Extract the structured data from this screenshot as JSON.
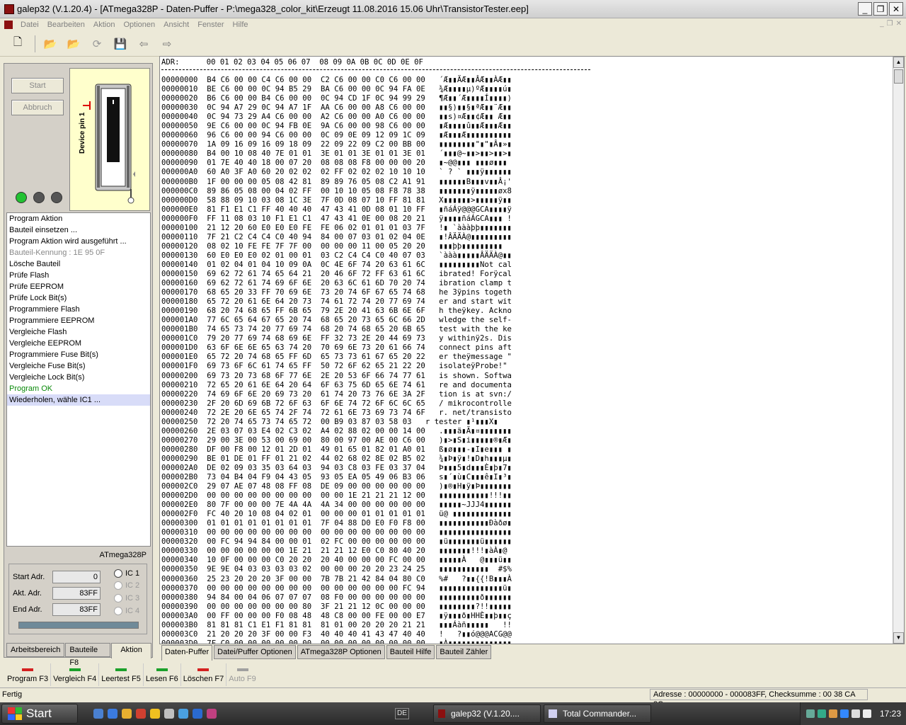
{
  "window": {
    "title": "galep32 (V.1.20.4) - [ATmega328P - Daten-Puffer - P:\\mega328_color_kit\\Erzeugt 11.08.2016 15.06 Uhr\\TransistorTester.eep]"
  },
  "menu": {
    "items": [
      "Datei",
      "Bearbeiten",
      "Aktion",
      "Optionen",
      "Ansicht",
      "Fenster",
      "Hilfe"
    ]
  },
  "toolbar": {
    "icons": [
      "new-file-icon",
      "open-folder-icon",
      "open-load-icon",
      "reload-icon",
      "save-icon",
      "back-arrow-icon",
      "forward-arrow-icon"
    ]
  },
  "left": {
    "start_label": "Start",
    "abort_label": "Abbruch",
    "socket_label": "Device pin 1",
    "log": [
      {
        "text": "Program Aktion",
        "style": ""
      },
      {
        "text": "Bauteil einsetzen ...",
        "style": ""
      },
      {
        "text": "Program Aktion wird ausgeführt ...",
        "style": ""
      },
      {
        "text": "Bauteil-Kennung : 1E 95 0F",
        "style": "grey"
      },
      {
        "text": "Lösche Bauteil",
        "style": ""
      },
      {
        "text": "Prüfe Flash",
        "style": ""
      },
      {
        "text": "Prüfe EEPROM",
        "style": ""
      },
      {
        "text": "Prüfe Lock Bit(s)",
        "style": ""
      },
      {
        "text": "Programmiere Flash",
        "style": ""
      },
      {
        "text": "Programmiere EEPROM",
        "style": ""
      },
      {
        "text": "Vergleiche Flash",
        "style": ""
      },
      {
        "text": "Vergleiche EEPROM",
        "style": ""
      },
      {
        "text": "Programmiere Fuse Bit(s)",
        "style": ""
      },
      {
        "text": "Vergleiche Fuse Bit(s)",
        "style": ""
      },
      {
        "text": "Vergleiche Lock Bit(s)",
        "style": ""
      },
      {
        "text": "Program OK",
        "style": "green"
      },
      {
        "text": "Wiederholen, wähle  IC1 ...",
        "style": "sel"
      }
    ],
    "chip": "ATmega328P",
    "start_adr_label": "Start Adr.",
    "start_adr": "0",
    "akt_adr_label": "Akt. Adr.",
    "akt_adr": "83FF",
    "end_adr_label": "End Adr.",
    "end_adr": "83FF",
    "ic": [
      "IC 1",
      "IC 2",
      "IC 3",
      "IC 4"
    ],
    "tabs": [
      "Arbeitsbereich",
      "Bauteile  F8",
      "Aktion"
    ]
  },
  "hex": {
    "header": "ADR:      00 01 02 03 04 05 06 07  08 09 0A 0B 0C 0D 0E 0F",
    "rows": [
      [
        "00000000",
        "B4 C6 00 00 C4 C6 00 00",
        "C2 C6 00 00 C0 C6 00 00",
        "´Æ▮▮ÄÆ▮▮ÂÆ▮▮ÀÆ▮▮"
      ],
      [
        "00000010",
        "BE C6 00 00 0C 94 B5 29",
        "BA C6 00 00 0C 94 FA 0E",
        "¾Æ▮▮▮▮µ)ºÆ▮▮▮▮ú▮"
      ],
      [
        "00000020",
        "B6 C6 00 00 B4 C6 00 00",
        "0C 94 CD 1F 0C 94 99 29",
        "¶Æ▮▮´Æ▮▮▮▮Í▮▮▮▮)"
      ],
      [
        "00000030",
        "0C 94 A7 29 0C 94 A7 1F",
        "AA C6 00 00 A8 C6 00 00",
        "▮▮§)▮▮§▮ªÆ▮▮¨Æ▮▮"
      ],
      [
        "00000040",
        "0C 94 73 29 A4 C6 00 00",
        "A2 C6 00 00 A0 C6 00 00",
        "▮▮s)¤Æ▮▮¢Æ▮▮ Æ▮▮"
      ],
      [
        "00000050",
        "9E C6 00 00 0C 94 FB 0E",
        "9A C6 00 00 98 C6 00 00",
        "▮Æ▮▮▮▮û▮▮Æ▮▮▮Æ▮▮"
      ],
      [
        "00000060",
        "96 C6 00 00 94 C6 00 00",
        "0C 09 0E 09 12 09 1C 09",
        "▮Æ▮▮▮Æ▮▮▮▮▮▮▮▮▮▮"
      ],
      [
        "00000070",
        "1A 09 16 09 16 09 18 09",
        "22 09 22 09 C2 00 BB 00",
        "▮▮▮▮▮▮▮▮\"▮\"▮Â▮»▮"
      ],
      [
        "00000080",
        "B4 00 10 08 40 7E 01 01",
        "3E 01 01 3E 01 01 3E 01",
        "´▮▮▮@~▮▮>▮▮>▮▮>▮"
      ],
      [
        "00000090",
        "01 7E 40 40 18 00 07 20",
        "08 08 08 F8 00 00 00 20",
        "▮~@@▮▮▮ ▮▮▮ø▮▮▮ "
      ],
      [
        "000000A0",
        "60 A0 3F A0 60 20 02 02",
        "02 FF 02 02 02 10 10 10",
        "` ? ` ▮▮▮ÿ▮▮▮▮▮▮"
      ],
      [
        "000000B0",
        "1F 00 00 00 05 08 42 81",
        "89 89 76 05 08 C2 A1 91",
        "▮▮▮▮▮▮B▮▮▮v▮▮Â¡'"
      ],
      [
        "000000C0",
        "89 86 05 08 00 04 02 FF",
        "00 10 10 05 08 F8 78 38",
        "▮▮▮▮▮▮▮ÿ▮▮▮▮▮øx8"
      ],
      [
        "000000D0",
        "58 88 09 10 03 08 1C 3E",
        "7F 0D 08 07 10 FF 81 81",
        "X▮▮▮▮▮▮>▮▮▮▮▮ÿ▮▮"
      ],
      [
        "000000E0",
        "81 F1 E1 C1 FF 40 40 40",
        "47 43 41 0D 08 01 10 FF",
        "▮ñáÁÿ@@@GCA▮▮▮▮ÿ"
      ],
      [
        "000000F0",
        "FF 11 08 03 10 F1 E1 C1",
        "47 43 41 0E 00 08 20 21",
        "ÿ▮▮▮▮ñáÁGCA▮▮▮ !"
      ],
      [
        "00000100",
        "21 12 20 60 E0 E0 E0 FE",
        "FE 06 02 01 01 01 03 7F",
        "!▮ `àààþþ▮▮▮▮▮▮▮"
      ],
      [
        "00000110",
        "7F 21 C2 C4 C4 C0 40 94",
        "84 00 07 03 01 02 04 0E",
        "▮!ÂÄÄÀ@▮▮▮▮▮▮▮▮▮"
      ],
      [
        "00000120",
        "08 02 10 FE FE 7F 7F 00",
        "00 00 00 11 00 05 20 20",
        "▮▮▮þþ▮▮▮▮▮▮▮▮▮  "
      ],
      [
        "00000130",
        "60 E0 E0 E0 02 01 00 01",
        "03 C2 C4 C4 C0 40 07 03",
        "`ààà▮▮▮▮▮ÂÄÄÀ@▮▮"
      ],
      [
        "00000140",
        "01 02 04 01 04 10 09 0A",
        "0C 4E 6F 74 20 63 61 6C",
        "▮▮▮▮▮▮▮▮▮Not cal"
      ],
      [
        "00000150",
        "69 62 72 61 74 65 64 21",
        "20 46 6F 72 FF 63 61 6C",
        "ibrated! Forÿcal"
      ],
      [
        "00000160",
        "69 62 72 61 74 69 6F 6E",
        "20 63 6C 61 6D 70 20 74",
        "ibration clamp t"
      ],
      [
        "00000170",
        "68 65 20 33 FF 70 69 6E",
        "73 20 74 6F 67 65 74 68",
        "he 3ÿpins togeth"
      ],
      [
        "00000180",
        "65 72 20 61 6E 64 20 73",
        "74 61 72 74 20 77 69 74",
        "er and start wit"
      ],
      [
        "00000190",
        "68 20 74 68 65 FF 6B 65",
        "79 2E 20 41 63 6B 6E 6F",
        "h theÿkey. Ackno"
      ],
      [
        "000001A0",
        "77 6C 65 64 67 65 20 74",
        "68 65 20 73 65 6C 66 2D",
        "wledge the self-"
      ],
      [
        "000001B0",
        "74 65 73 74 20 77 69 74",
        "68 20 74 68 65 20 6B 65",
        "test with the ke"
      ],
      [
        "000001C0",
        "79 20 77 69 74 68 69 6E",
        "FF 32 73 2E 20 44 69 73",
        "y withinÿ2s. Dis"
      ],
      [
        "000001D0",
        "63 6F 6E 6E 65 63 74 20",
        "70 69 6E 73 20 61 66 74",
        "connect pins aft"
      ],
      [
        "000001E0",
        "65 72 20 74 68 65 FF 6D",
        "65 73 73 61 67 65 20 22",
        "er theÿmessage \""
      ],
      [
        "000001F0",
        "69 73 6F 6C 61 74 65 FF",
        "50 72 6F 62 65 21 22 20",
        "isolateÿProbe!\" "
      ],
      [
        "00000200",
        "69 73 20 73 68 6F 77 6E",
        "2E 20 53 6F 66 74 77 61",
        "is shown. Softwa"
      ],
      [
        "00000210",
        "72 65 20 61 6E 64 20 64",
        "6F 63 75 6D 65 6E 74 61",
        "re and documenta"
      ],
      [
        "00000220",
        "74 69 6F 6E 20 69 73 20",
        "61 74 20 73 76 6E 3A 2F",
        "tion is at svn:/"
      ],
      [
        "00000230",
        "2F 20 6D 69 6B 72 6F 63",
        "6F 6E 74 72 6F 6C 6C 65",
        "/ mikrocontrolle"
      ],
      [
        "00000240",
        "72 2E 20 6E 65 74 2F 74",
        "72 61 6E 73 69 73 74 6F",
        "r. net/transisto"
      ],
      [
        "00000250",
        "72 20 74 65 73 74 65 72",
        "00 B9 03 87 03 58 03",
        "r tester ▮¹▮▮▮X▮"
      ],
      [
        "00000260",
        "2E 03 07 03 E4 02 C3 02",
        "A4 02 88 02 00 00 14 00",
        ".▮▮▮ä▮Ã▮¤▮▮▮▮▮▮▮"
      ],
      [
        "00000270",
        "29 00 3E 00 53 00 69 00",
        "80 00 97 00 AE 00 C6 00",
        ")▮>▮S▮i▮▮▮▮▮®▮Æ▮"
      ],
      [
        "00000280",
        "DF 00 F8 00 12 01 2D 01",
        "49 01 65 01 82 01 A0 01",
        "ß▮ø▮▮▮-▮I▮e▮▮▮ ▮"
      ],
      [
        "00000290",
        "BE 01 DE 01 FF 01 21 02",
        "44 02 68 02 8E 02 B5 02",
        "¾▮Þ▮ÿ▮!▮D▮h▮▮▮µ▮"
      ],
      [
        "000002A0",
        "DE 02 09 03 35 03 64 03",
        "94 03 C8 03 FE 03 37 04",
        "Þ▮▮▮5▮d▮▮▮È▮þ▮7▮"
      ],
      [
        "000002B0",
        "73 04 B4 04 F9 04 43 05",
        "93 05 EA 05 49 06 B3 06",
        "s▮´▮ù▮C▮▮▮ê▮I▮³▮"
      ],
      [
        "000002C0",
        "29 07 AE 07 48 08 FF 08",
        "DE 09 00 00 00 00 00 00",
        ")▮®▮H▮ÿ▮Þ▮▮▮▮▮▮▮"
      ],
      [
        "000002D0",
        "00 00 00 00 00 00 00 00",
        "00 00 1E 21 21 21 12 00",
        "▮▮▮▮▮▮▮▮▮▮▮!!!▮▮"
      ],
      [
        "000002E0",
        "80 7F 00 00 00 7E 4A 4A",
        "4A 34 00 00 00 00 00 00",
        "▮▮▮▮▮~JJJ4▮▮▮▮▮▮"
      ],
      [
        "000002F0",
        "FC 40 20 10 08 04 02 01",
        "00 00 00 01 01 01 01 01",
        "ü@ ▮▮▮▮▮▮▮▮▮▮▮▮▮"
      ],
      [
        "00000300",
        "01 01 01 01 01 01 01 01",
        "7F 04 88 D0 E0 F0 F8 00",
        "▮▮▮▮▮▮▮▮▮▮▮Ðàðø▮"
      ],
      [
        "00000310",
        "00 00 00 00 00 00 00 00",
        "00 00 00 00 00 00 00 00",
        "▮▮▮▮▮▮▮▮▮▮▮▮▮▮▮▮"
      ],
      [
        "00000320",
        "00 FC 94 94 84 00 00 01",
        "02 FC 00 00 00 00 00 00",
        "▮ü▮▮▮▮▮▮▮ü▮▮▮▮▮▮"
      ],
      [
        "00000330",
        "00 00 00 00 00 00 1E 21",
        "21 21 12 E0 C0 80 40 20",
        "▮▮▮▮▮▮▮!!!▮àÀ▮@ "
      ],
      [
        "00000340",
        "10 0F 00 00 00 C0 20 20",
        "20 40 00 00 00 FC 00 00",
        "▮▮▮▮▮À   @▮▮▮ü▮▮"
      ],
      [
        "00000350",
        "9E 9E 04 03 03 03 03 02",
        "00 00 00 20 20 23 24 25",
        "▮▮▮▮▮▮▮▮▮▮▮  #$%"
      ],
      [
        "00000360",
        "25 23 20 20 20 3F 00 00",
        "7B 7B 21 42 84 04 80 C0",
        "%#   ?▮▮{{!B▮▮▮À"
      ],
      [
        "00000370",
        "00 00 00 00 00 00 00 00",
        "00 00 00 00 00 00 FC 94",
        "▮▮▮▮▮▮▮▮▮▮▮▮▮▮ü▮"
      ],
      [
        "00000380",
        "94 84 00 04 06 07 07 07",
        "08 F0 00 00 00 00 00 00",
        "▮▮▮▮▮▮▮▮▮ð▮▮▮▮▮▮"
      ],
      [
        "00000390",
        "00 00 00 00 00 00 00 80",
        "3F 21 21 12 0C 00 00 00",
        "▮▮▮▮▮▮▮▮?!!▮▮▮▮▮"
      ],
      [
        "000003A0",
        "00 FF 00 00 00 F0 08 48",
        "48 C8 00 00 FE 00 00 E7",
        "▮ÿ▮▮▮ð▮HHÈ▮▮þ▮▮ç"
      ],
      [
        "000003B0",
        "81 81 81 C1 E1 F1 81 81",
        "81 01 00 20 20 20 21 21",
        "▮▮▮Áàñ▮▮▮▮▮   !!"
      ],
      [
        "000003C0",
        "21 20 20 20 3F 00 00 F3",
        "40 40 40 41 43 47 40 40",
        "!   ?▮▮ó@@@ACG@@"
      ],
      [
        "000003D0",
        "7F C0 00 00 00 00 00 00",
        "00 00 00 00 00 00 00 00",
        "▮À▮▮▮▮▮▮▮▮▮▮▮▮▮▮"
      ]
    ],
    "tabs": [
      "Daten-Puffer",
      "Datei/Puffer Optionen",
      "ATmega328P Optionen",
      "Bauteil Hilfe",
      "Bauteil Zähler"
    ]
  },
  "fkeys": [
    {
      "label": "Program F3",
      "color": "#d42020",
      "enabled": true
    },
    {
      "label": "Vergleich F4",
      "color": "#1aa02a",
      "enabled": true
    },
    {
      "label": "Leertest F5",
      "color": "#1aa02a",
      "enabled": true
    },
    {
      "label": "Lesen F6",
      "color": "#1aa02a",
      "enabled": true
    },
    {
      "label": "Löschen F7",
      "color": "#d42020",
      "enabled": true
    },
    {
      "label": "Auto F9",
      "color": "#a0a0a0",
      "enabled": false
    }
  ],
  "status": {
    "left": "Fertig",
    "right": "Adresse : 00000000 - 000083FF, Checksumme : 00 38 CA 3C"
  },
  "taskbar": {
    "start_label": "Start",
    "lang": "DE",
    "tasks": [
      "galep32 (V.1.20....",
      "Total Commander..."
    ],
    "clock": "17:23"
  }
}
